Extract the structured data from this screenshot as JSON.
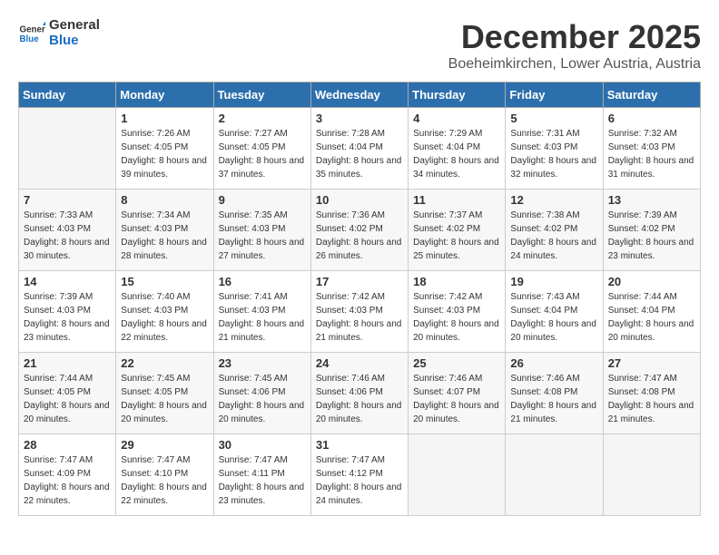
{
  "logo": {
    "text_general": "General",
    "text_blue": "Blue"
  },
  "header": {
    "month": "December 2025",
    "location": "Boeheimkirchen, Lower Austria, Austria"
  },
  "weekdays": [
    "Sunday",
    "Monday",
    "Tuesday",
    "Wednesday",
    "Thursday",
    "Friday",
    "Saturday"
  ],
  "weeks": [
    [
      {
        "day": "",
        "empty": true
      },
      {
        "day": "1",
        "sunrise": "7:26 AM",
        "sunset": "4:05 PM",
        "daylight": "8 hours and 39 minutes."
      },
      {
        "day": "2",
        "sunrise": "7:27 AM",
        "sunset": "4:05 PM",
        "daylight": "8 hours and 37 minutes."
      },
      {
        "day": "3",
        "sunrise": "7:28 AM",
        "sunset": "4:04 PM",
        "daylight": "8 hours and 35 minutes."
      },
      {
        "day": "4",
        "sunrise": "7:29 AM",
        "sunset": "4:04 PM",
        "daylight": "8 hours and 34 minutes."
      },
      {
        "day": "5",
        "sunrise": "7:31 AM",
        "sunset": "4:03 PM",
        "daylight": "8 hours and 32 minutes."
      },
      {
        "day": "6",
        "sunrise": "7:32 AM",
        "sunset": "4:03 PM",
        "daylight": "8 hours and 31 minutes."
      }
    ],
    [
      {
        "day": "7",
        "sunrise": "7:33 AM",
        "sunset": "4:03 PM",
        "daylight": "8 hours and 30 minutes."
      },
      {
        "day": "8",
        "sunrise": "7:34 AM",
        "sunset": "4:03 PM",
        "daylight": "8 hours and 28 minutes."
      },
      {
        "day": "9",
        "sunrise": "7:35 AM",
        "sunset": "4:03 PM",
        "daylight": "8 hours and 27 minutes."
      },
      {
        "day": "10",
        "sunrise": "7:36 AM",
        "sunset": "4:02 PM",
        "daylight": "8 hours and 26 minutes."
      },
      {
        "day": "11",
        "sunrise": "7:37 AM",
        "sunset": "4:02 PM",
        "daylight": "8 hours and 25 minutes."
      },
      {
        "day": "12",
        "sunrise": "7:38 AM",
        "sunset": "4:02 PM",
        "daylight": "8 hours and 24 minutes."
      },
      {
        "day": "13",
        "sunrise": "7:39 AM",
        "sunset": "4:02 PM",
        "daylight": "8 hours and 23 minutes."
      }
    ],
    [
      {
        "day": "14",
        "sunrise": "7:39 AM",
        "sunset": "4:03 PM",
        "daylight": "8 hours and 23 minutes."
      },
      {
        "day": "15",
        "sunrise": "7:40 AM",
        "sunset": "4:03 PM",
        "daylight": "8 hours and 22 minutes."
      },
      {
        "day": "16",
        "sunrise": "7:41 AM",
        "sunset": "4:03 PM",
        "daylight": "8 hours and 21 minutes."
      },
      {
        "day": "17",
        "sunrise": "7:42 AM",
        "sunset": "4:03 PM",
        "daylight": "8 hours and 21 minutes."
      },
      {
        "day": "18",
        "sunrise": "7:42 AM",
        "sunset": "4:03 PM",
        "daylight": "8 hours and 20 minutes."
      },
      {
        "day": "19",
        "sunrise": "7:43 AM",
        "sunset": "4:04 PM",
        "daylight": "8 hours and 20 minutes."
      },
      {
        "day": "20",
        "sunrise": "7:44 AM",
        "sunset": "4:04 PM",
        "daylight": "8 hours and 20 minutes."
      }
    ],
    [
      {
        "day": "21",
        "sunrise": "7:44 AM",
        "sunset": "4:05 PM",
        "daylight": "8 hours and 20 minutes."
      },
      {
        "day": "22",
        "sunrise": "7:45 AM",
        "sunset": "4:05 PM",
        "daylight": "8 hours and 20 minutes."
      },
      {
        "day": "23",
        "sunrise": "7:45 AM",
        "sunset": "4:06 PM",
        "daylight": "8 hours and 20 minutes."
      },
      {
        "day": "24",
        "sunrise": "7:46 AM",
        "sunset": "4:06 PM",
        "daylight": "8 hours and 20 minutes."
      },
      {
        "day": "25",
        "sunrise": "7:46 AM",
        "sunset": "4:07 PM",
        "daylight": "8 hours and 20 minutes."
      },
      {
        "day": "26",
        "sunrise": "7:46 AM",
        "sunset": "4:08 PM",
        "daylight": "8 hours and 21 minutes."
      },
      {
        "day": "27",
        "sunrise": "7:47 AM",
        "sunset": "4:08 PM",
        "daylight": "8 hours and 21 minutes."
      }
    ],
    [
      {
        "day": "28",
        "sunrise": "7:47 AM",
        "sunset": "4:09 PM",
        "daylight": "8 hours and 22 minutes."
      },
      {
        "day": "29",
        "sunrise": "7:47 AM",
        "sunset": "4:10 PM",
        "daylight": "8 hours and 22 minutes."
      },
      {
        "day": "30",
        "sunrise": "7:47 AM",
        "sunset": "4:11 PM",
        "daylight": "8 hours and 23 minutes."
      },
      {
        "day": "31",
        "sunrise": "7:47 AM",
        "sunset": "4:12 PM",
        "daylight": "8 hours and 24 minutes."
      },
      {
        "day": "",
        "empty": true
      },
      {
        "day": "",
        "empty": true
      },
      {
        "day": "",
        "empty": true
      }
    ]
  ],
  "labels": {
    "sunrise": "Sunrise:",
    "sunset": "Sunset:",
    "daylight": "Daylight:"
  }
}
